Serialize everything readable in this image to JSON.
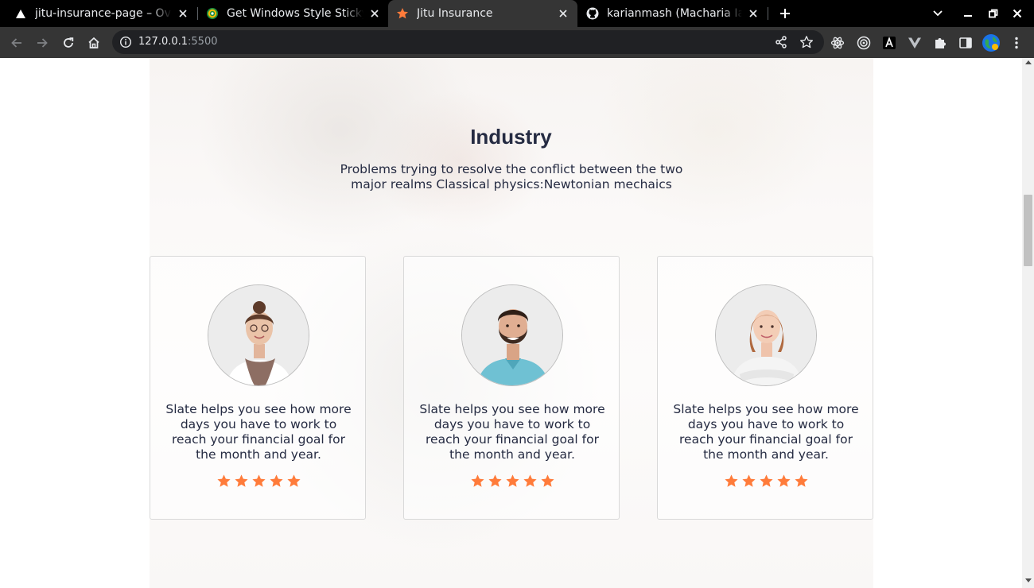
{
  "browser": {
    "tabs": [
      {
        "title": "jitu-insurance-page – Overview",
        "icon": "vercel-triangle-icon"
      },
      {
        "title": "Get Windows Style Sticky Notes",
        "icon": "sticky-notes-icon"
      },
      {
        "title": "Jitu Insurance",
        "icon": "orange-star-icon",
        "active": true
      },
      {
        "title": "karianmash (Macharia Ian)",
        "icon": "github-icon"
      }
    ],
    "url_host": "127.0.0.1",
    "url_port": ":5500"
  },
  "section": {
    "title": "Industry",
    "subtitle": "Problems trying to resolve the conflict between the two major realms Classical physics:Newtonian mechaics"
  },
  "cards": [
    {
      "text": "Slate helps you see how more days you have to work to reach your financial goal for the month and year.",
      "rating": 5
    },
    {
      "text": "Slate helps you see how more days you have to work to reach your financial goal for the month and year.",
      "rating": 5
    },
    {
      "text": "Slate helps you see how more days you have to work to reach your financial goal for the month and year.",
      "rating": 5
    }
  ],
  "colors": {
    "star": "#ff7b3a",
    "heading": "#252b42",
    "active_tab": "#353535"
  }
}
